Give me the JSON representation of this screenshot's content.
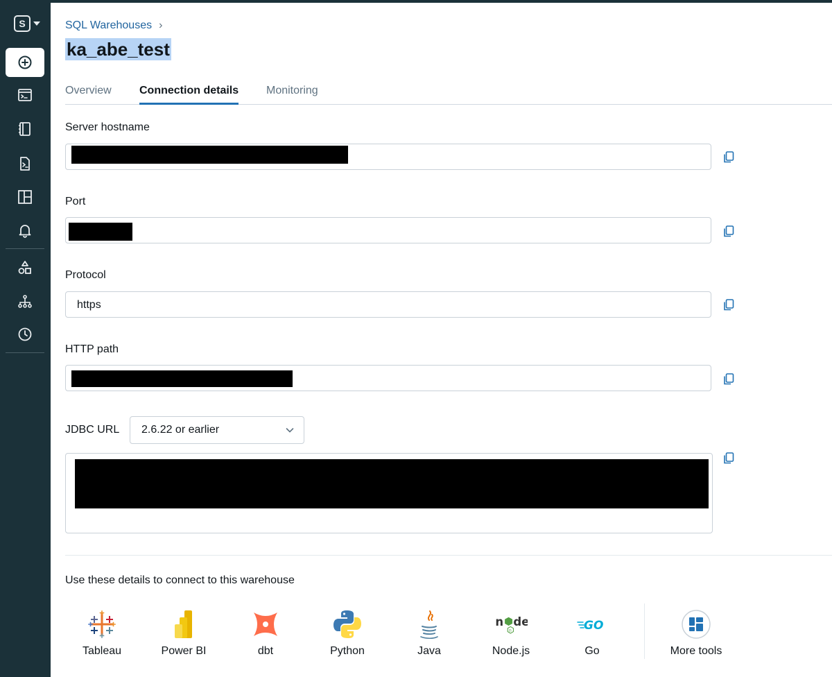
{
  "sidebar": {
    "workspace_initial": "S",
    "items": [
      {
        "icon": "new-plus-icon"
      },
      {
        "icon": "sql-editor-icon"
      },
      {
        "icon": "queries-icon"
      },
      {
        "icon": "sql-file-icon"
      },
      {
        "icon": "dashboards-icon"
      },
      {
        "icon": "alerts-bell-icon"
      },
      {
        "icon": "catalog-shapes-icon"
      },
      {
        "icon": "workflows-hierarchy-icon"
      },
      {
        "icon": "history-clock-icon"
      }
    ]
  },
  "breadcrumb": {
    "label": "SQL Warehouses",
    "separator": "›"
  },
  "page": {
    "title": "ka_abe_test"
  },
  "tabs": [
    {
      "label": "Overview",
      "active": false
    },
    {
      "label": "Connection details",
      "active": true
    },
    {
      "label": "Monitoring",
      "active": false
    }
  ],
  "fields": {
    "server_hostname": {
      "label": "Server hostname",
      "value": "",
      "redacted": true
    },
    "port": {
      "label": "Port",
      "value": "",
      "redacted": true
    },
    "protocol": {
      "label": "Protocol",
      "value": "https"
    },
    "http_path": {
      "label": "HTTP path",
      "value": "",
      "redacted": true
    },
    "jdbc": {
      "label": "JDBC URL",
      "version_selected": "2.6.22 or earlier",
      "value": "",
      "redacted": true
    }
  },
  "connect": {
    "hint": "Use these details to connect to this warehouse",
    "tools": [
      {
        "name": "Tableau",
        "icon": "tableau-logo-icon"
      },
      {
        "name": "Power BI",
        "icon": "powerbi-logo-icon"
      },
      {
        "name": "dbt",
        "icon": "dbt-logo-icon"
      },
      {
        "name": "Python",
        "icon": "python-logo-icon"
      },
      {
        "name": "Java",
        "icon": "java-logo-icon"
      },
      {
        "name": "Node.js",
        "icon": "nodejs-logo-icon"
      },
      {
        "name": "Go",
        "icon": "go-logo-icon"
      },
      {
        "name": "More tools",
        "icon": "more-tools-grid-icon"
      }
    ]
  },
  "colors": {
    "sidebar_bg": "#1b3139",
    "link": "#22659f",
    "tab_active_underline": "#2272b4",
    "title_highlight": "#b7d4f5",
    "redaction": "#000000"
  }
}
